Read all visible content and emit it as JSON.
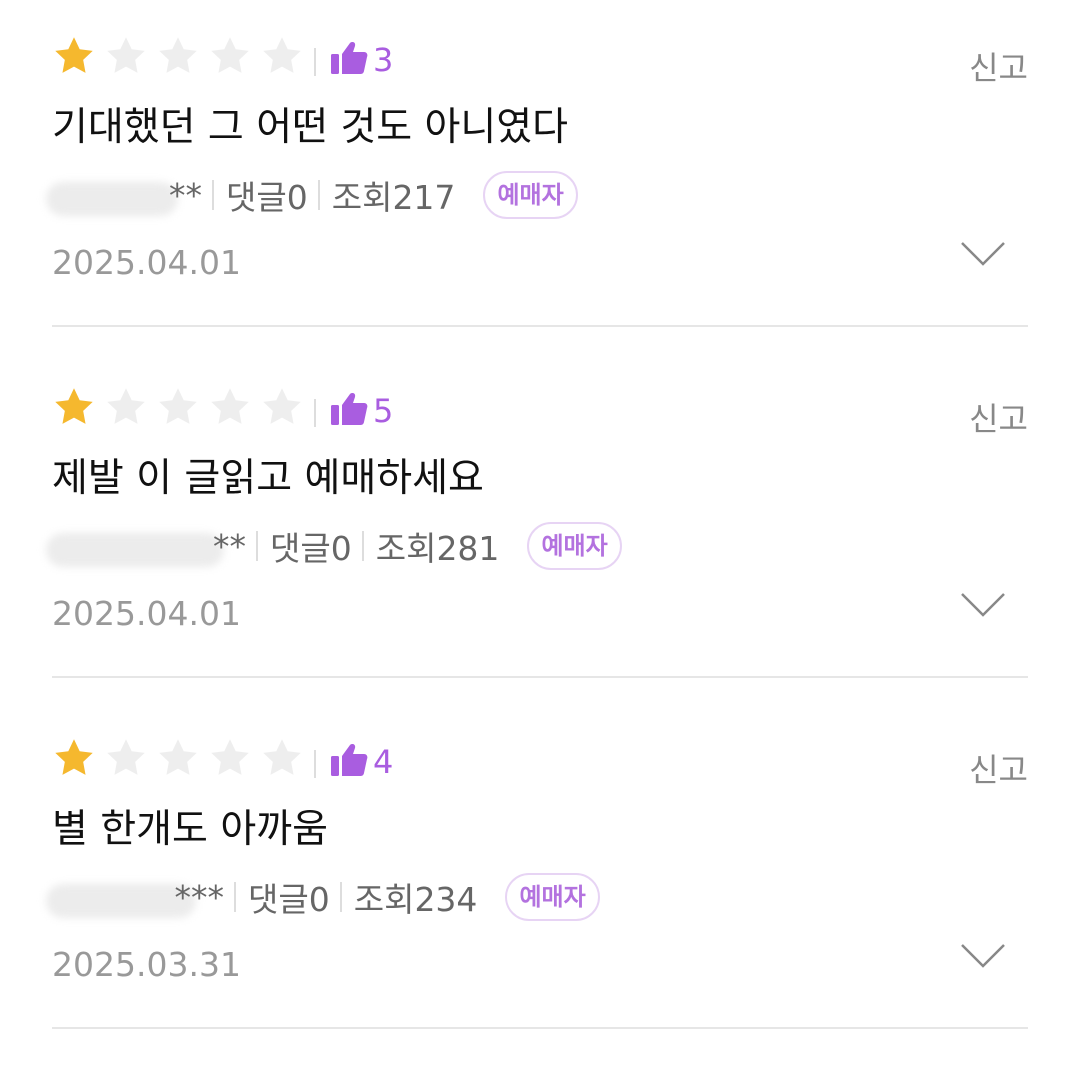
{
  "reviews": [
    {
      "rating": 1,
      "like_count": "3",
      "report_label": "신고",
      "title": "기대했던 그 어떤 것도 아니였다",
      "author": "**",
      "comments": "댓글0",
      "views": "조회217",
      "badge": "예매자",
      "date": "2025.04.01"
    },
    {
      "rating": 1,
      "like_count": "5",
      "report_label": "신고",
      "title": "제발 이 글읽고 예매하세요",
      "author": "**",
      "comments": "댓글0",
      "views": "조회281",
      "badge": "예매자",
      "date": "2025.04.01"
    },
    {
      "rating": 1,
      "like_count": "4",
      "report_label": "신고",
      "title": "별 한개도 아까움",
      "author": "***",
      "comments": "댓글0",
      "views": "조회234",
      "badge": "예매자",
      "date": "2025.03.31"
    }
  ],
  "colors": {
    "star_filled": "#f5b82e",
    "star_empty": "#eeeeee",
    "accent_purple": "#a95de0",
    "badge_border": "#e7d4f4",
    "divider": "#e6e6e6"
  },
  "icons": {
    "star": "star-icon",
    "thumb": "thumbs-up-icon",
    "expand": "chevron-down-icon"
  }
}
